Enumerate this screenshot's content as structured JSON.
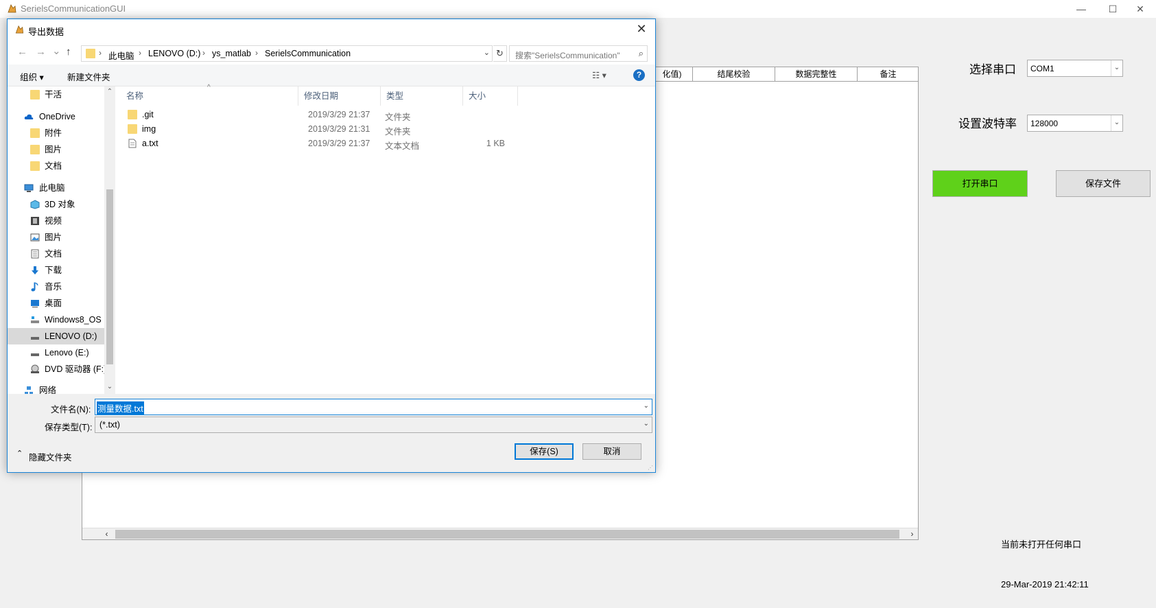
{
  "main_window": {
    "title": "SerielsCommunicationGUI",
    "controls": {
      "minimize": "—",
      "maximize": "☐",
      "close": "✕"
    }
  },
  "table": {
    "columns": [
      "化值)",
      "结尾校验",
      "数据完整性",
      "备注"
    ]
  },
  "right_panel": {
    "port_label": "选择串口",
    "port_value": "COM1",
    "baud_label": "设置波特率",
    "baud_value": "128000",
    "open_button": "打开串口",
    "save_button": "保存文件",
    "status_text": "当前未打开任何串口",
    "datetime": "29-Mar-2019 21:42:11",
    "colors": {
      "open_button_bg": "#5fd11a",
      "save_button_bg": "#e1e1e1"
    }
  },
  "dialog": {
    "title": "导出数据",
    "close": "✕",
    "nav": {
      "back": "←",
      "forward": "→",
      "recent": "⌄",
      "up": "↑"
    },
    "breadcrumb": [
      "此电脑",
      "LENOVO (D:)",
      "ys_matlab",
      "SerielsCommunication"
    ],
    "refresh": "↻",
    "search_placeholder": "搜索\"SerielsCommunication\"",
    "toolbar": {
      "organize": "组织 ▾",
      "new_folder": "新建文件夹",
      "view": "☷ ▾",
      "help": "?"
    },
    "nav_items": [
      {
        "label": "干活",
        "icon": "folder-icon"
      },
      {
        "label": "OneDrive",
        "icon": "cloud-icon"
      },
      {
        "label": "附件",
        "icon": "folder-icon"
      },
      {
        "label": "图片",
        "icon": "folder-icon"
      },
      {
        "label": "文档",
        "icon": "folder-icon"
      },
      {
        "label": "此电脑",
        "icon": "computer-icon"
      },
      {
        "label": "3D 对象",
        "icon": "cube-icon"
      },
      {
        "label": "视频",
        "icon": "video-icon"
      },
      {
        "label": "图片",
        "icon": "picture-icon"
      },
      {
        "label": "文档",
        "icon": "document-icon"
      },
      {
        "label": "下载",
        "icon": "download-icon"
      },
      {
        "label": "音乐",
        "icon": "music-icon"
      },
      {
        "label": "桌面",
        "icon": "desktop-icon"
      },
      {
        "label": "Windows8_OS",
        "icon": "drive-icon"
      },
      {
        "label": "LENOVO (D:)",
        "icon": "drive-icon"
      },
      {
        "label": "Lenovo (E:)",
        "icon": "drive-icon"
      },
      {
        "label": "DVD 驱动器 (F:)",
        "icon": "dvd-icon"
      },
      {
        "label": "网络",
        "icon": "network-icon"
      }
    ],
    "columns": {
      "name": "名称",
      "date": "修改日期",
      "type": "类型",
      "size": "大小"
    },
    "files": [
      {
        "name": ".git",
        "date": "2019/3/29 21:37",
        "type": "文件夹",
        "size": "",
        "icon": "folder-icon"
      },
      {
        "name": "img",
        "date": "2019/3/29 21:31",
        "type": "文件夹",
        "size": "",
        "icon": "folder-icon"
      },
      {
        "name": "a.txt",
        "date": "2019/3/29 21:37",
        "type": "文本文档",
        "size": "1 KB",
        "icon": "text-file-icon"
      }
    ],
    "filename_label": "文件名(N):",
    "filename_value": "测量数据.txt",
    "filetype_label": "保存类型(T):",
    "filetype_value": "(*.txt)",
    "hide_folders": "隐藏文件夹",
    "save_button": "保存(S)",
    "cancel_button": "取消"
  }
}
